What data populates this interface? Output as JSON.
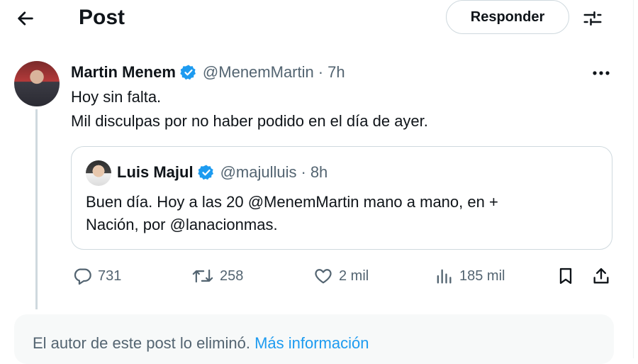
{
  "header": {
    "title": "Post",
    "back_icon": "arrow-left-icon",
    "reply_label": "Responder",
    "settings_icon": "sliders-icon"
  },
  "post": {
    "author_name": "Martin Menem",
    "handle": "@MenemMartin",
    "separator": "·",
    "time": "7h",
    "verified_color": "#1d9bf0",
    "more_icon": "more-icon",
    "text_line1": "Hoy sin falta.",
    "text_line2": "Mil disculpas por no haber podido en el día de ayer."
  },
  "quote": {
    "author_name": "Luis Majul",
    "handle": "@majulluis",
    "separator": "·",
    "time": "8h",
    "text_line1": "Buen día. Hoy a las 20 @MenemMartin mano a mano, en +",
    "text_line2": "Nación, por @lanacionmas."
  },
  "actions": {
    "replies": "731",
    "reposts": "258",
    "likes": "2 mil",
    "views": "185 mil"
  },
  "notice": {
    "text": "El autor de este post lo eliminó.",
    "link": "Más información"
  },
  "colors": {
    "accent": "#1d9bf0",
    "text": "#0f1419",
    "muted": "#536471",
    "border": "#cfd9de"
  }
}
